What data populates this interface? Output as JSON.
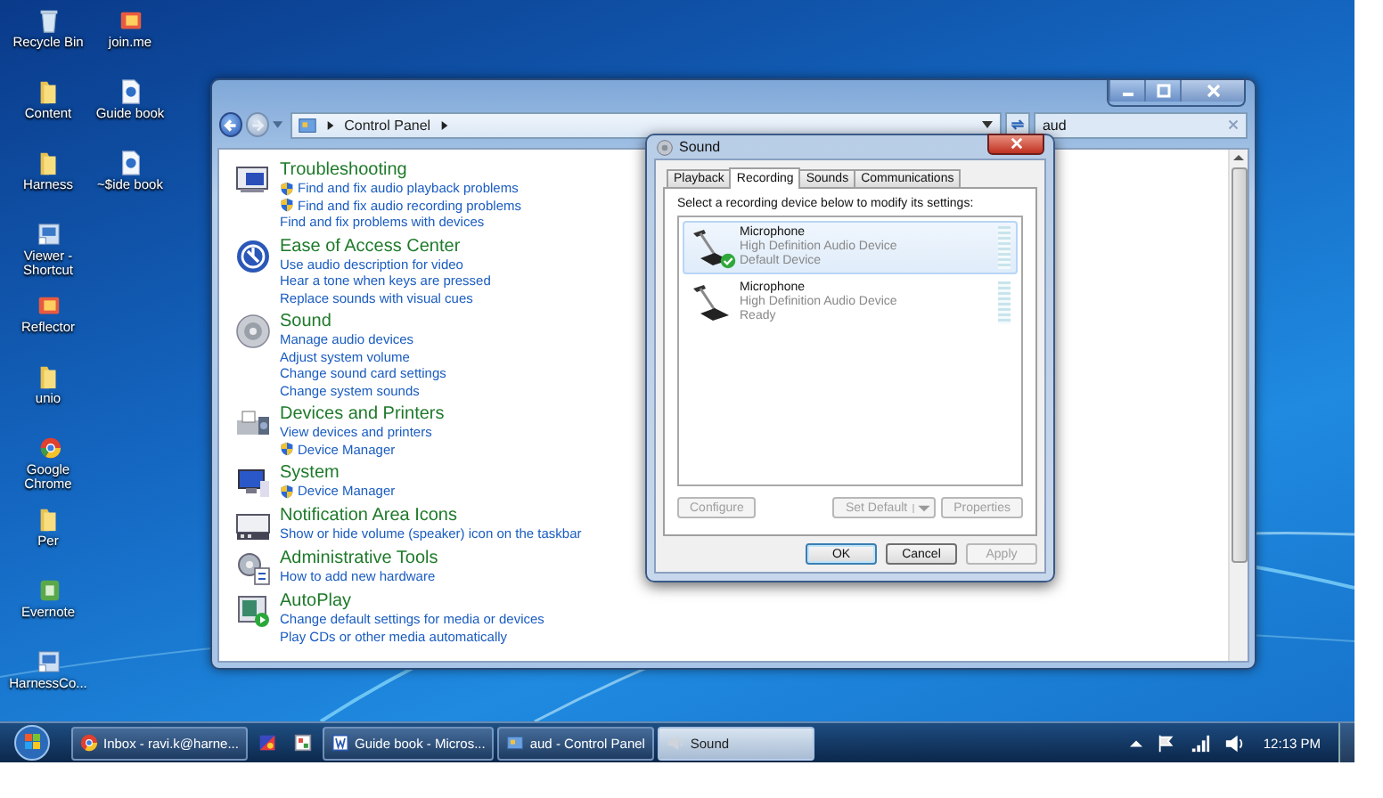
{
  "desktop": {
    "columns": [
      {
        "icons": [
          {
            "label": "Recycle Bin",
            "kind": "bin"
          },
          {
            "label": "Content",
            "kind": "folder"
          },
          {
            "label": "Harness",
            "kind": "folder"
          },
          {
            "label": "Viewer - Shortcut",
            "kind": "shortcut"
          },
          {
            "label": "Reflector",
            "kind": "app"
          },
          {
            "label": "unio",
            "kind": "folder"
          },
          {
            "label": "Google Chrome",
            "kind": "browser"
          },
          {
            "label": "Per",
            "kind": "folder"
          },
          {
            "label": "Evernote",
            "kind": "note"
          },
          {
            "label": "HarnessCo...",
            "kind": "shortcut"
          }
        ]
      },
      {
        "icons": [
          {
            "label": "join.me",
            "kind": "app"
          },
          {
            "label": "Guide book",
            "kind": "document"
          },
          {
            "label": "~$ide book",
            "kind": "document"
          }
        ]
      }
    ]
  },
  "control_panel": {
    "breadcrumb": "Control Panel",
    "search": {
      "value": "aud"
    },
    "sections": [
      {
        "title": "Troubleshooting",
        "kind": "troubleshooting",
        "links": [
          {
            "text": "Find and fix audio playback problems",
            "shield": true
          },
          {
            "text": "Find and fix audio recording problems",
            "shield": true
          },
          {
            "text": "Find and fix problems with devices",
            "shield": false
          }
        ]
      },
      {
        "title": "Ease of Access Center",
        "kind": "ease",
        "links": [
          {
            "text": "Use audio description for video",
            "shield": false
          },
          {
            "text": "Hear a tone when keys are pressed",
            "shield": false
          },
          {
            "text": "Replace sounds with visual cues",
            "shield": false
          }
        ]
      },
      {
        "title": "Sound",
        "kind": "sound",
        "links": [
          {
            "text": "Manage audio devices",
            "shield": false
          },
          {
            "text": "Adjust system volume",
            "shield": false
          },
          {
            "text": "Change sound card settings",
            "shield": false
          },
          {
            "text": "Change system sounds",
            "shield": false
          }
        ]
      },
      {
        "title": "Devices and Printers",
        "kind": "devices",
        "links": [
          {
            "text": "View devices and printers",
            "shield": false
          },
          {
            "text": "Device Manager",
            "shield": true
          }
        ]
      },
      {
        "title": "System",
        "kind": "system",
        "links": [
          {
            "text": "Device Manager",
            "shield": true
          }
        ]
      },
      {
        "title": "Notification Area Icons",
        "kind": "notification",
        "links": [
          {
            "text": "Show or hide volume (speaker) icon on the taskbar",
            "shield": false
          }
        ]
      },
      {
        "title": "Administrative Tools",
        "kind": "admin",
        "links": [
          {
            "text": "How to add new hardware",
            "shield": false
          }
        ]
      },
      {
        "title": "AutoPlay",
        "kind": "autoplay",
        "links": [
          {
            "text": "Change default settings for media or devices",
            "shield": false
          },
          {
            "text": "Play CDs or other media automatically",
            "shield": false
          }
        ]
      }
    ]
  },
  "sound_dialog": {
    "title": "Sound",
    "tabs": [
      {
        "label": "Playback",
        "selected": false
      },
      {
        "label": "Recording",
        "selected": true
      },
      {
        "label": "Sounds",
        "selected": false
      },
      {
        "label": "Communications",
        "selected": false
      }
    ],
    "instruction": "Select a recording device below to modify its settings:",
    "devices": [
      {
        "name": "Microphone",
        "driver": "High Definition Audio Device",
        "status": "Default Device",
        "default": true,
        "selected": true,
        "level": 0
      },
      {
        "name": "Microphone",
        "driver": "High Definition Audio Device",
        "status": "Ready",
        "default": false,
        "selected": false,
        "level": 0
      }
    ],
    "device_buttons": [
      {
        "label": "Configure",
        "kind": "plain",
        "disabled": true
      },
      {
        "label": "Set Default",
        "kind": "split",
        "disabled": true
      },
      {
        "label": "Properties",
        "kind": "plain",
        "disabled": true
      }
    ],
    "dialog_buttons": [
      {
        "label": "OK",
        "kind": "default",
        "disabled": false
      },
      {
        "label": "Cancel",
        "kind": "plain",
        "disabled": false
      },
      {
        "label": "Apply",
        "kind": "plain",
        "disabled": true
      }
    ]
  },
  "taskbar": {
    "items": [
      {
        "label": "Inbox - ravi.k@harne...",
        "kind": "browser",
        "selected": false
      },
      {
        "kind": "paint",
        "selected": false
      },
      {
        "kind": "app",
        "selected": false
      },
      {
        "label": "Guide book - Micros...",
        "kind": "word",
        "selected": false
      },
      {
        "label": "aud - Control Panel",
        "kind": "control-panel",
        "selected": false
      },
      {
        "label": "Sound",
        "kind": "sound",
        "selected": true
      }
    ],
    "clock": "12:13 PM"
  }
}
